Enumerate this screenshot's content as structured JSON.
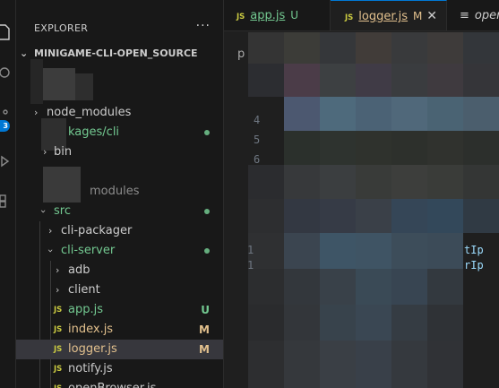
{
  "activity_bar": {
    "icons": [
      "files-icon",
      "search-icon",
      "source-control-icon",
      "run-debug-icon",
      "extensions-icon"
    ],
    "scm_badge": "3"
  },
  "sidebar": {
    "title": "EXPLORER",
    "more": "···",
    "root": "MINIGAME-CLI-OPEN_SOURCE",
    "items": [
      {
        "label": "node_modules",
        "color": "#cccccc"
      },
      {
        "label": "kages/cli",
        "color": "#73c991"
      },
      {
        "label": "bin",
        "color": "#cccccc"
      },
      {
        "label": "modules",
        "color": "#8c8c8c"
      },
      {
        "label": "src",
        "color": "#73c991"
      },
      {
        "label": "cli-packager",
        "color": "#cccccc"
      },
      {
        "label": "cli-server",
        "color": "#73c991"
      },
      {
        "label": "adb",
        "color": "#cccccc"
      },
      {
        "label": "client",
        "color": "#cccccc"
      },
      {
        "label": "app.js",
        "color": "#73c991",
        "status": "U",
        "status_color": "#73c991"
      },
      {
        "label": "index.js",
        "color": "#e2c08d",
        "status": "M",
        "status_color": "#e2c08d"
      },
      {
        "label": "logger.js",
        "color": "#e2c08d",
        "status": "M",
        "status_color": "#e2c08d"
      },
      {
        "label": "notify.js",
        "color": "#cccccc"
      },
      {
        "label": "openBrowser.js",
        "color": "#cccccc"
      }
    ],
    "js_badge": "JS"
  },
  "tabs": [
    {
      "name": "app.js",
      "status": "U"
    },
    {
      "name": "logger.js",
      "status": "M",
      "close": "✕"
    },
    {
      "name": "open"
    }
  ],
  "editor": {
    "breadcrumb": "p",
    "line_numbers": [
      "4",
      "5",
      "6",
      "1",
      "1"
    ],
    "fragments": [
      "tIp",
      "rIp"
    ]
  }
}
